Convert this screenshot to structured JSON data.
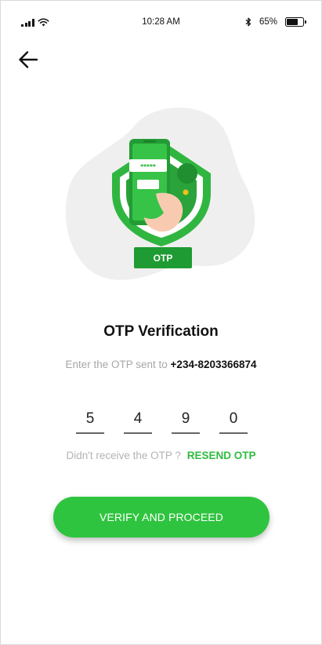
{
  "status_bar": {
    "time": "10:28 AM",
    "battery_label": "65%",
    "battery_level": 0.65
  },
  "illustration": {
    "badge_label": "OTP",
    "password_mask": "*****"
  },
  "content": {
    "title": "OTP Verification",
    "subtitle_prefix": "Enter the OTP sent to",
    "phone": "+234-8203366874"
  },
  "otp": {
    "digits": [
      "5",
      "4",
      "9",
      "0"
    ]
  },
  "resend": {
    "question": "Didn't receive the OTP ?",
    "action": "RESEND OTP"
  },
  "actions": {
    "verify_label": "VERIFY AND PROCEED"
  },
  "colors": {
    "accent": "#2fc43f",
    "accent_dark": "#249a35",
    "blob": "#efefef"
  },
  "icons": {
    "back": "arrow-left-icon",
    "wifi": "wifi-icon",
    "signal": "signal-icon",
    "bluetooth": "bluetooth-icon",
    "battery": "battery-icon"
  }
}
